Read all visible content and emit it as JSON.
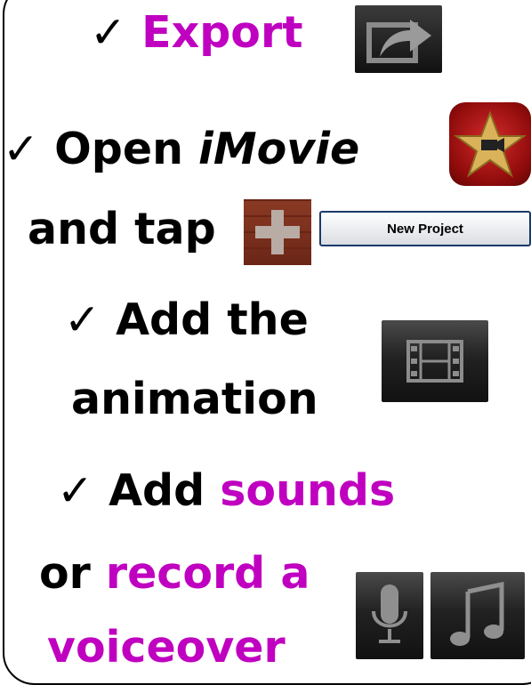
{
  "check_mark": "✓",
  "lines": {
    "export": "Export",
    "open": "Open",
    "imovie": "iMovie",
    "and_tap": "and tap",
    "add_the": "Add the",
    "animation": "animation",
    "add": "Add",
    "sounds": "sounds",
    "or": "or",
    "record_a": "record a",
    "voiceover": "voiceover"
  },
  "new_project_button": "New Project",
  "colors": {
    "accent": "#c000c0",
    "text": "#000000"
  },
  "icons": [
    "checkmark-icon",
    "export-icon",
    "imovie-icon",
    "add-plus-icon",
    "film-icon",
    "microphone-icon",
    "music-note-icon"
  ]
}
